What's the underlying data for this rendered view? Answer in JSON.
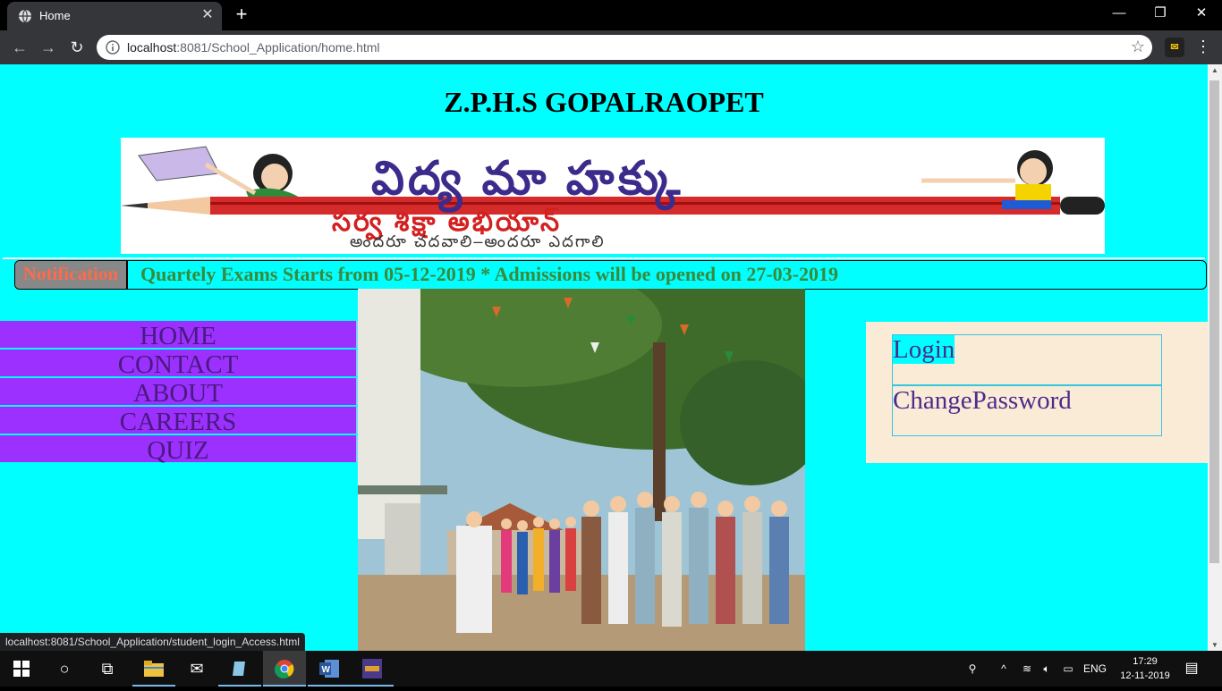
{
  "browser": {
    "tab_title": "Home",
    "url_host": "localhost",
    "url_rest": ":8081/School_Application/home.html",
    "new_tab_symbol": "+",
    "minimize_symbol": "—",
    "restore_symbol": "❐",
    "close_symbol": "✕",
    "tab_close_symbol": "✕",
    "back_symbol": "←",
    "forward_symbol": "→",
    "reload_symbol": "↻",
    "star_symbol": "☆",
    "menu_symbol": "⋮"
  },
  "page": {
    "school_name": "Z.P.H.S GOPALRAOPET",
    "banner": {
      "line1": "విద్య మా హక్కు",
      "line2": "సర్వ శిక్షా అభియాన్",
      "line3": "అందరూ చదవాలి–అందరూ ఎదగాలి"
    },
    "notification": {
      "label": "Notification",
      "text": "Quartely Exams Starts from 05-12-2019 * Admissions will be opened on 27-03-2019"
    },
    "nav": [
      {
        "label": "HOME"
      },
      {
        "label": "CONTACT"
      },
      {
        "label": "ABOUT"
      },
      {
        "label": "CAREERS"
      },
      {
        "label": "QUIZ"
      }
    ],
    "login_panel": {
      "login": "Login",
      "change_password": "ChangePassword"
    }
  },
  "status_url": "localhost:8081/School_Application/student_login_Access.html",
  "taskbar": {
    "language": "ENG",
    "time": "17:29",
    "date": "12-11-2019"
  },
  "colors": {
    "page_background": "#00ffff",
    "nav_background": "#9b30ff",
    "nav_text": "#4a1a80",
    "notification_text": "#3a8a3a",
    "notification_label_text": "#ff6b4a",
    "login_panel_bg": "#faebd7"
  }
}
